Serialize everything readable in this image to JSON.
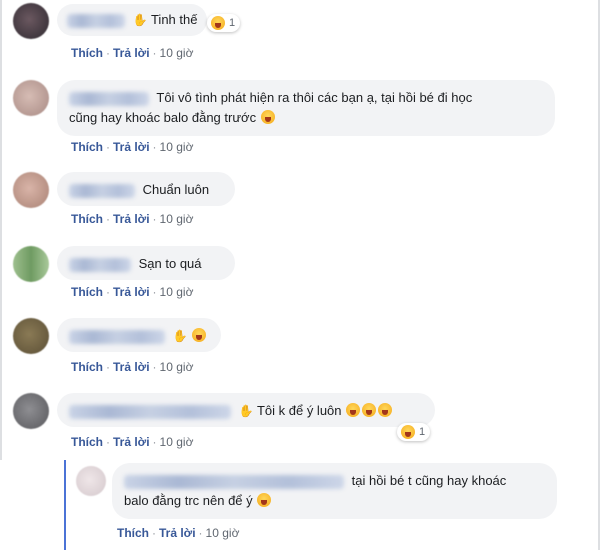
{
  "actions": {
    "like": "Thích",
    "reply": "Trả lời",
    "time": "10 giờ",
    "dot": "·"
  },
  "comments": [
    {
      "text": "Tinh thế",
      "reaction_count": "1"
    },
    {
      "text_line1": "Tôi vô tình phát hiện ra thôi các bạn ạ, tại hồi bé đi học",
      "text_line2": "cũng hay khoác balo đằng trước"
    },
    {
      "text": "Chuẩn luôn"
    },
    {
      "text": "Sạn to quá"
    },
    {
      "text": ""
    },
    {
      "text": "Tôi k để ý luôn",
      "reaction_count": "1"
    }
  ],
  "reply": {
    "text_line1": "tại hồi bé t cũng hay khoác",
    "text_line2": "balo đằng trc nên để ý"
  },
  "colors": {
    "link": "#385898",
    "bubble": "#f2f3f5",
    "thread": "#4b73d6"
  }
}
